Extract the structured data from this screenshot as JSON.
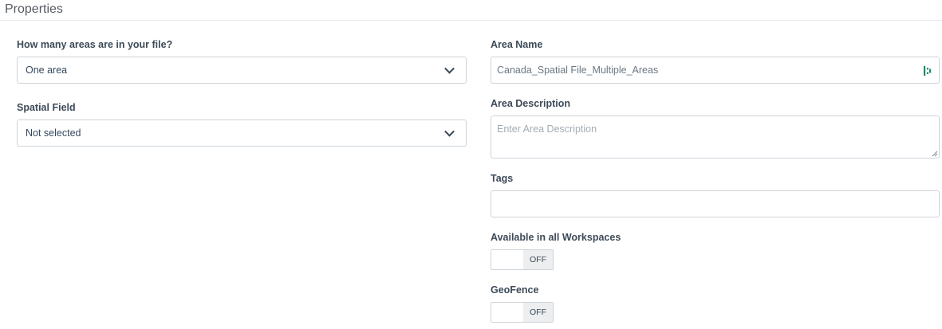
{
  "section": {
    "title": "Properties"
  },
  "left": {
    "areas_count": {
      "label": "How many areas are in your file?",
      "selected": "One area"
    },
    "spatial_field": {
      "label": "Spatial Field",
      "selected": "Not selected"
    }
  },
  "right": {
    "area_name": {
      "label": "Area Name",
      "value": "Canada_Spatial File_Multiple_Areas",
      "icon": "password-manager-icon",
      "icon_color": "#1a8a6e"
    },
    "area_description": {
      "label": "Area Description",
      "placeholder": "Enter Area Description"
    },
    "tags": {
      "label": "Tags",
      "value": ""
    },
    "available_all_workspaces": {
      "label": "Available in all Workspaces",
      "state": "OFF"
    },
    "geofence": {
      "label": "GeoFence",
      "state": "OFF"
    }
  }
}
